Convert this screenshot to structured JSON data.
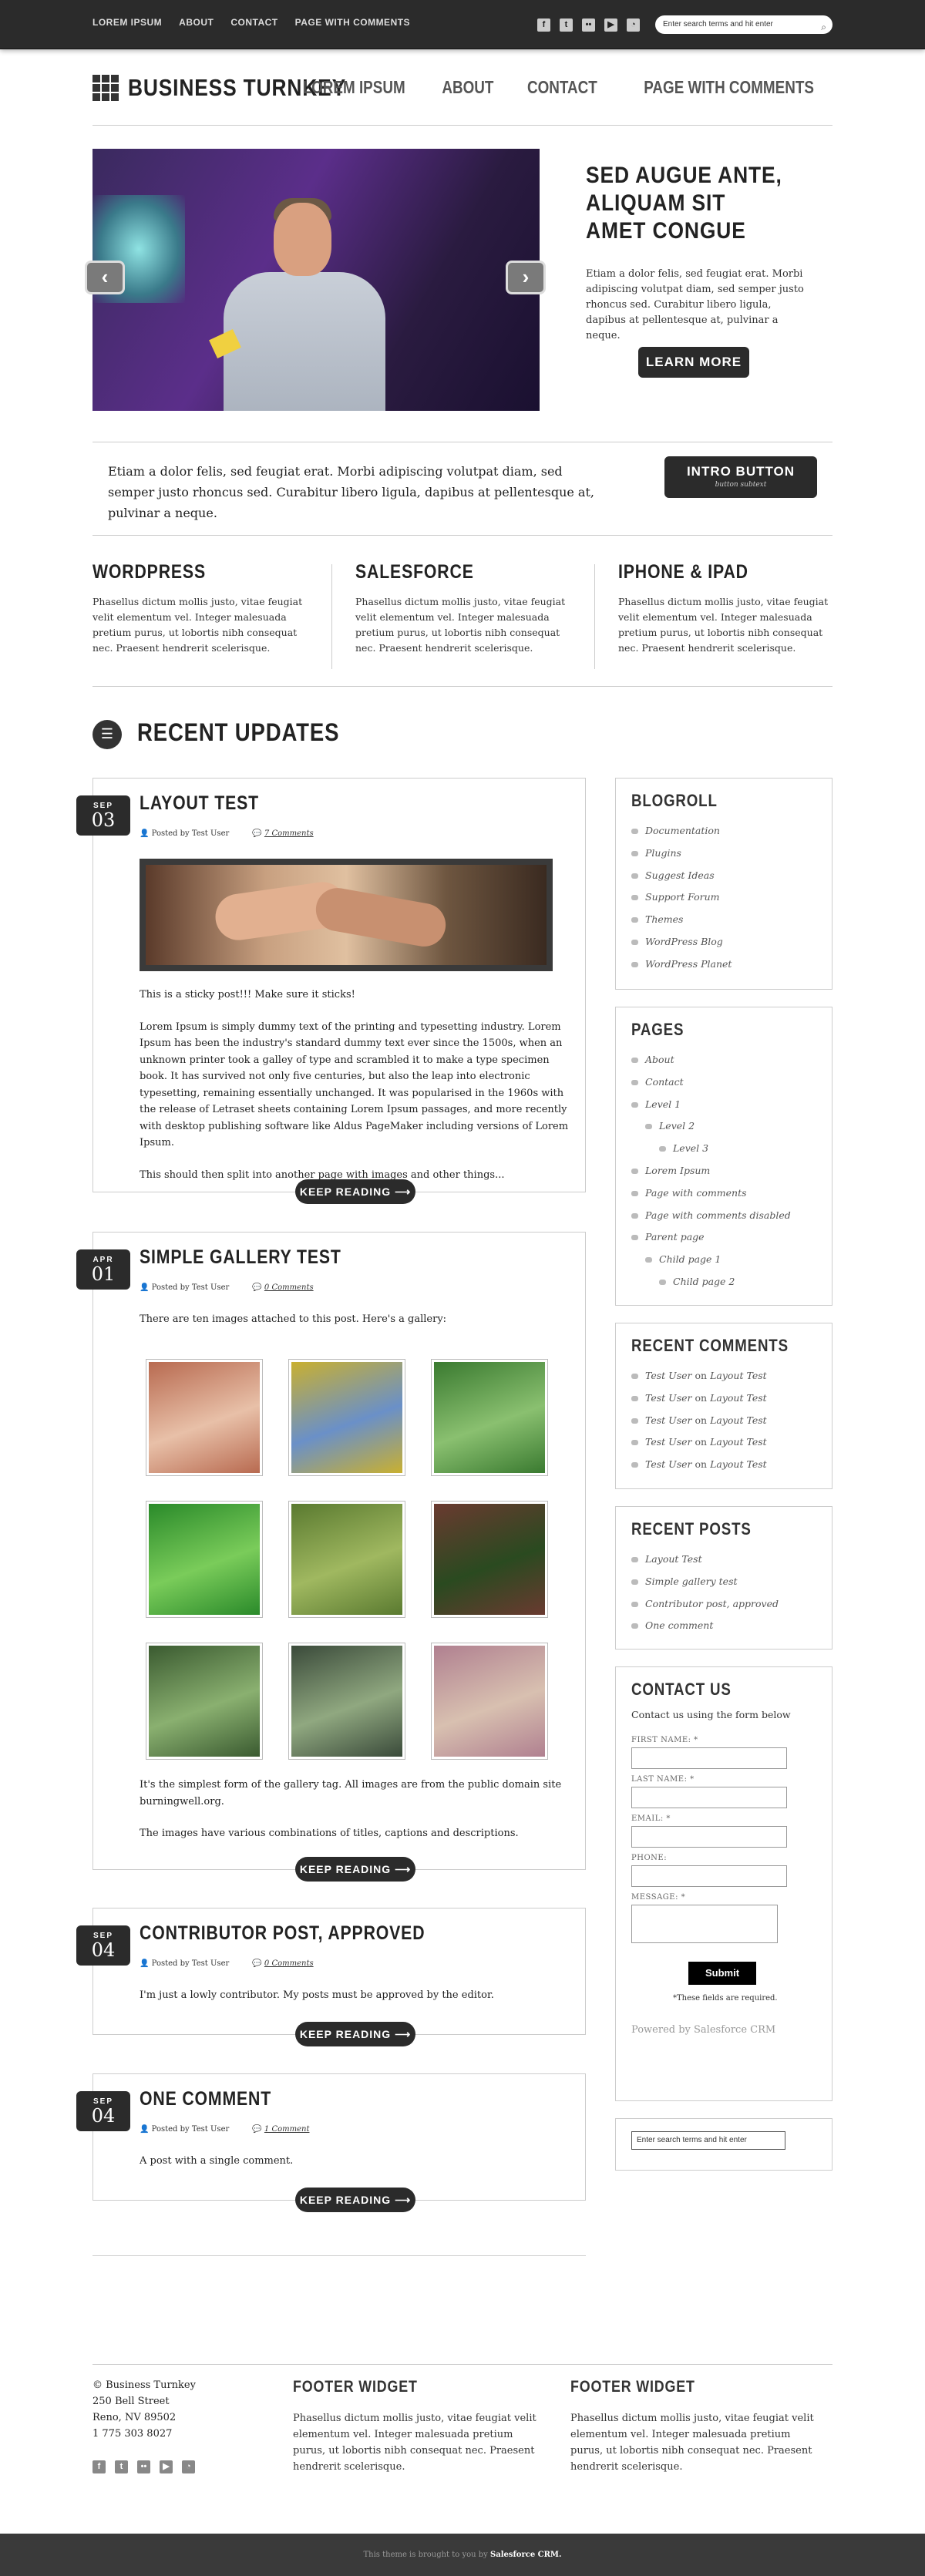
{
  "topbar": {
    "nav": [
      "LOREM IPSUM",
      "ABOUT",
      "CONTACT",
      "PAGE WITH COMMENTS"
    ],
    "social_icons": [
      "facebook-icon",
      "twitter-icon",
      "flickr-icon",
      "youtube-icon",
      "rss-icon"
    ],
    "search_placeholder": "Enter search terms and hit enter"
  },
  "header": {
    "logo": "BUSINESS TURNKEY",
    "nav": [
      "LOREM IPSUM",
      "ABOUT",
      "CONTACT",
      "PAGE WITH COMMENTS"
    ]
  },
  "hero": {
    "prev": "‹",
    "next": "›",
    "title": "SED AUGUE ANTE, ALIQUAM SIT AMET CONGUE",
    "text": "Etiam a dolor felis, sed feugiat erat. Morbi adipiscing volutpat diam, sed semper justo rhoncus sed. Curabitur libero ligula, dapibus at pellentesque at, pulvinar a neque.",
    "button": "LEARN MORE"
  },
  "intro": {
    "text": "Etiam a dolor felis, sed feugiat erat. Morbi adipiscing volutpat diam, sed semper justo rhoncus sed. Curabitur libero ligula, dapibus at pellentesque at, pulvinar a neque.",
    "button": "INTRO BUTTON",
    "button_sub": "button subtext"
  },
  "features": [
    {
      "title": "WORDPRESS",
      "text": "Phasellus dictum mollis justo, vitae feugiat velit elementum vel. Integer malesuada pretium purus, ut lobortis nibh consequat nec. Praesent hendrerit scelerisque."
    },
    {
      "title": "SALESFORCE",
      "text": "Phasellus dictum mollis justo, vitae feugiat velit elementum vel. Integer malesuada pretium purus, ut lobortis nibh consequat nec. Praesent hendrerit scelerisque."
    },
    {
      "title": "IPHONE & IPAD",
      "text": "Phasellus dictum mollis justo, vitae feugiat velit elementum vel. Integer malesuada pretium purus, ut lobortis nibh consequat nec. Praesent hendrerit scelerisque."
    }
  ],
  "recent_updates": {
    "title": "RECENT UPDATES"
  },
  "posts": [
    {
      "month": "SEP",
      "day": "03",
      "title": "LAYOUT TEST",
      "author": "Posted by Test User",
      "comments": "7 Comments",
      "paragraphs": [
        "This is a sticky post!!! Make sure it sticks!",
        "Lorem Ipsum is simply dummy text of the printing and typesetting industry. Lorem Ipsum has been the industry's standard dummy text ever since the 1500s, when an unknown printer took a galley of type and scrambled it to make a type specimen book. It has survived not only five centuries, but also the leap into electronic typesetting, remaining essentially unchanged. It was popularised in the 1960s with the release of Letraset sheets containing Lorem Ipsum passages, and more recently with desktop publishing software like Aldus PageMaker including versions of Lorem Ipsum.",
        "This should then split into another page with images and other things..."
      ],
      "keep": "KEEP READING ⟶"
    },
    {
      "month": "APR",
      "day": "01",
      "title": "SIMPLE GALLERY TEST",
      "author": "Posted by Test User",
      "comments": "0 Comments",
      "intro": "There are ten images attached to this post.  Here's a gallery:",
      "paragraphs": [
        "It's the simplest form of the gallery tag.  All images are from the public domain site burningwell.org.",
        "The images have various combinations of titles, captions and descriptions."
      ],
      "keep": "KEEP READING ⟶"
    },
    {
      "month": "SEP",
      "day": "04",
      "title": "CONTRIBUTOR POST, APPROVED",
      "author": "Posted by Test User",
      "comments": "0 Comments",
      "paragraphs": [
        "I'm just a lowly contributor.  My posts must be approved by the editor."
      ],
      "keep": "KEEP READING ⟶"
    },
    {
      "month": "SEP",
      "day": "04",
      "title": "ONE COMMENT",
      "author": "Posted by Test User",
      "comments": "1 Comment",
      "paragraphs": [
        "A post with a single comment."
      ],
      "keep": "KEEP READING ⟶"
    }
  ],
  "gallery_colors": [
    [
      "#b86a50",
      "#e8c0a8"
    ],
    [
      "#c9b030",
      "#6a90c8"
    ],
    [
      "#3a7a30",
      "#8ac070"
    ],
    [
      "#2a8a2a",
      "#7acc5a"
    ],
    [
      "#5a7a30",
      "#a0b860"
    ],
    [
      "#6a3a30",
      "#2a4a20"
    ],
    [
      "#3a5a30",
      "#8ab070"
    ],
    [
      "#3a4a3a",
      "#90a880"
    ],
    [
      "#b08090",
      "#d8c0b0"
    ]
  ],
  "sidebar": {
    "blogroll": {
      "title": "BLOGROLL",
      "items": [
        "Documentation",
        "Plugins",
        "Suggest Ideas",
        "Support Forum",
        "Themes",
        "WordPress Blog",
        "WordPress Planet"
      ]
    },
    "pages": {
      "title": "PAGES",
      "items": [
        {
          "label": "About",
          "level": 1
        },
        {
          "label": "Contact",
          "level": 1
        },
        {
          "label": "Level 1",
          "level": 1
        },
        {
          "label": "Level 2",
          "level": 2
        },
        {
          "label": "Level 3",
          "level": 3
        },
        {
          "label": "Lorem Ipsum",
          "level": 1
        },
        {
          "label": "Page with comments",
          "level": 1
        },
        {
          "label": "Page with comments disabled",
          "level": 1
        },
        {
          "label": "Parent page",
          "level": 1
        },
        {
          "label": "Child page 1",
          "level": 2
        },
        {
          "label": "Child page 2",
          "level": 3
        }
      ]
    },
    "recent_comments": {
      "title": "RECENT COMMENTS",
      "user": "Test User",
      "on": "on",
      "post": "Layout Test",
      "count": 5
    },
    "recent_posts": {
      "title": "RECENT POSTS",
      "items": [
        "Layout Test",
        "Simple gallery test",
        "Contributor post, approved",
        "One comment"
      ]
    },
    "contact": {
      "title": "CONTACT US",
      "intro": "Contact us using the form below",
      "fields": [
        "FIRST NAME: *",
        "LAST NAME: *",
        "EMAIL: *",
        "PHONE:"
      ],
      "message": "MESSAGE: *",
      "submit": "Submit",
      "required": "*These fields are required.",
      "powered": "Powered by Salesforce CRM"
    },
    "search_placeholder": "Enter search terms and hit enter"
  },
  "footer": {
    "address": [
      "© Business Turnkey",
      "250 Bell Street",
      "Reno, NV 89502",
      "1 775 303 8027"
    ],
    "social_icons": [
      "facebook-icon",
      "twitter-icon",
      "flickr-icon",
      "youtube-icon",
      "rss-icon"
    ],
    "widget_title": "FOOTER WIDGET",
    "widget_text": "Phasellus dictum mollis justo, vitae feugiat velit elementum vel. Integer malesuada pretium purus, ut lobortis nibh consequat nec. Praesent hendrerit scelerisque.",
    "credit_prefix": "This theme is brought to you by",
    "credit_link": "Salesforce CRM."
  }
}
